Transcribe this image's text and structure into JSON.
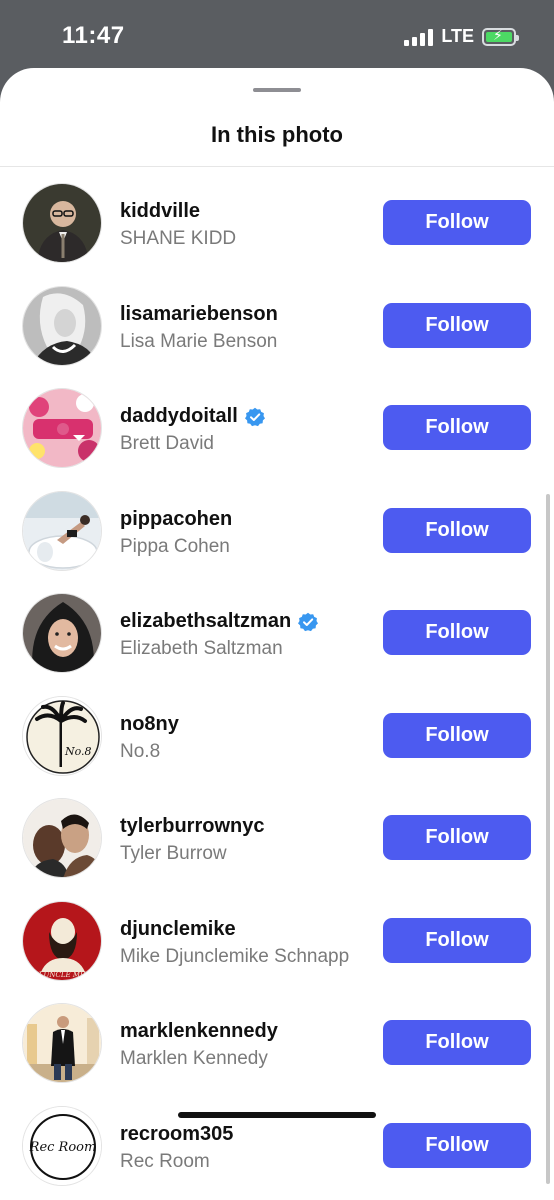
{
  "status_bar": {
    "time": "11:47",
    "network": "LTE",
    "battery_charging": true,
    "icons": [
      "signal-icon",
      "battery-icon"
    ]
  },
  "sheet": {
    "title": "In this photo"
  },
  "people": [
    {
      "username": "kiddville",
      "full_name": "SHANE KIDD",
      "verified": false,
      "button": "Follow"
    },
    {
      "username": "lisamariebenson",
      "full_name": "Lisa Marie Benson",
      "verified": false,
      "button": "Follow"
    },
    {
      "username": "daddydoitall",
      "full_name": "Brett David",
      "verified": true,
      "button": "Follow"
    },
    {
      "username": "pippacohen",
      "full_name": "Pippa Cohen",
      "verified": false,
      "button": "Follow"
    },
    {
      "username": "elizabethsaltzman",
      "full_name": "Elizabeth Saltzman",
      "verified": true,
      "button": "Follow"
    },
    {
      "username": "no8ny",
      "full_name": "No.8",
      "verified": false,
      "button": "Follow",
      "avatar_text": "No.8"
    },
    {
      "username": "tylerburrownyc",
      "full_name": "Tyler Burrow",
      "verified": false,
      "button": "Follow"
    },
    {
      "username": "djunclemike",
      "full_name": "Mike Djunclemike Schnapp",
      "verified": false,
      "button": "Follow",
      "avatar_text": "DJ UNCLE MIKE"
    },
    {
      "username": "marklenkennedy",
      "full_name": "Marklen Kennedy",
      "verified": false,
      "button": "Follow"
    },
    {
      "username": "recroom305",
      "full_name": "Rec Room",
      "verified": false,
      "button": "Follow",
      "avatar_text": "Rec Room"
    }
  ],
  "colors": {
    "follow_button": "#4d5bf0",
    "verified_badge": "#3897f0",
    "dimmed_background": "#5a5d61"
  }
}
